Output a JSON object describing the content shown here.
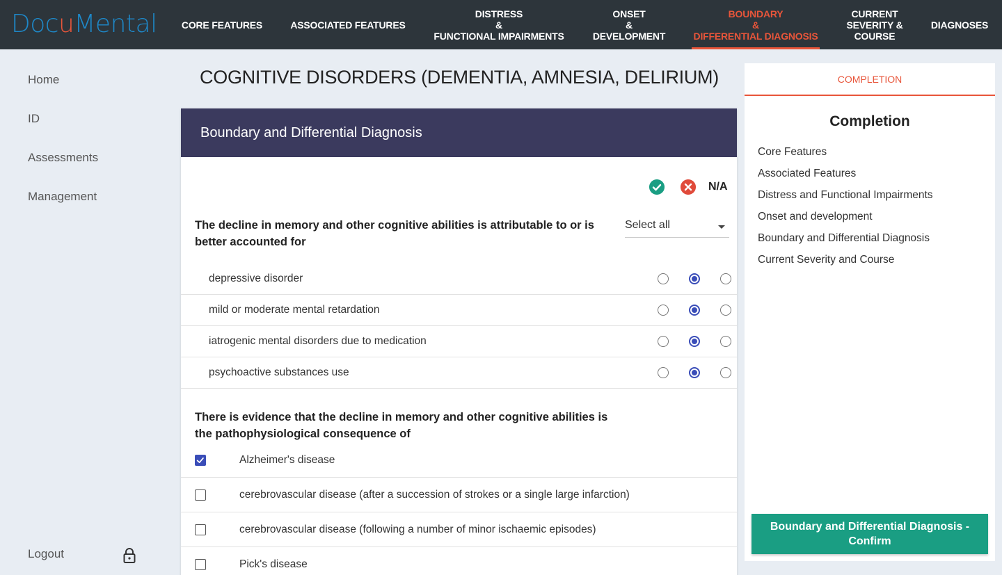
{
  "app": {
    "logo_pre": "Docu",
    "logo_u": "u",
    "logo_post": "Mental",
    "logo_prefix": "Doc",
    "logo_suffix": "Mental",
    "brand_color": "#1e88c8",
    "accent_color": "#e8553a"
  },
  "nav": {
    "items": [
      {
        "lines": [
          "CORE FEATURES"
        ]
      },
      {
        "lines": [
          "ASSOCIATED FEATURES"
        ]
      },
      {
        "lines": [
          "DISTRESS",
          "&",
          "FUNCTIONAL IMPAIRMENTS"
        ]
      },
      {
        "lines": [
          "ONSET",
          "&",
          "DEVELOPMENT"
        ]
      },
      {
        "lines": [
          "BOUNDARY",
          "&",
          "DIFFERENTIAL DIAGNOSIS"
        ]
      },
      {
        "lines": [
          "CURRENT",
          "SEVERITY &",
          "COURSE"
        ]
      },
      {
        "lines": [
          "DIAGNOSES"
        ]
      }
    ],
    "active_index": 4
  },
  "sidebar": {
    "items": [
      "Home",
      "ID",
      "Assessments",
      "Management"
    ],
    "logout": "Logout",
    "logout_icon": "lock-icon"
  },
  "page": {
    "title": "COGNITIVE DISORDERS (DEMENTIA, AMNESIA, DELIRIUM)"
  },
  "card": {
    "header": "Boundary and Differential Diagnosis",
    "legend": {
      "yes_icon": "check-circle-icon",
      "no_icon": "x-circle-icon",
      "na_label": "N/A",
      "yes_color": "#1a9e83",
      "no_color": "#e04a3a"
    },
    "question1": {
      "text": "The decline in memory and other cognitive abilities is attributable to or is better accounted for",
      "select_value": "Select all",
      "rows": [
        {
          "label": "depressive disorder",
          "selected": "no"
        },
        {
          "label": "mild or moderate mental retardation",
          "selected": "no"
        },
        {
          "label": "iatrogenic mental disorders due to medication",
          "selected": "no"
        },
        {
          "label": "psychoactive substances use",
          "selected": "no"
        }
      ]
    },
    "question2": {
      "text": "There is evidence that the decline in memory and other cognitive abilities is the pathophysiological consequence of",
      "rows": [
        {
          "label": "Alzheimer's disease",
          "checked": true
        },
        {
          "label": "cerebrovascular disease (after a succession of strokes or a single large infarction)",
          "checked": false
        },
        {
          "label": "cerebrovascular disease (following a number of minor ischaemic episodes)",
          "checked": false
        },
        {
          "label": "Pick's disease",
          "checked": false
        }
      ]
    }
  },
  "completion": {
    "tab_label": "COMPLETION",
    "title": "Completion",
    "items": [
      "Core Features",
      "Associated Features",
      "Distress and Functional Impairments",
      "Onset and development",
      "Boundary and Differential Diagnosis",
      "Current Severity and Course"
    ],
    "confirm_label": "Boundary and Differential Diagnosis - Confirm"
  }
}
